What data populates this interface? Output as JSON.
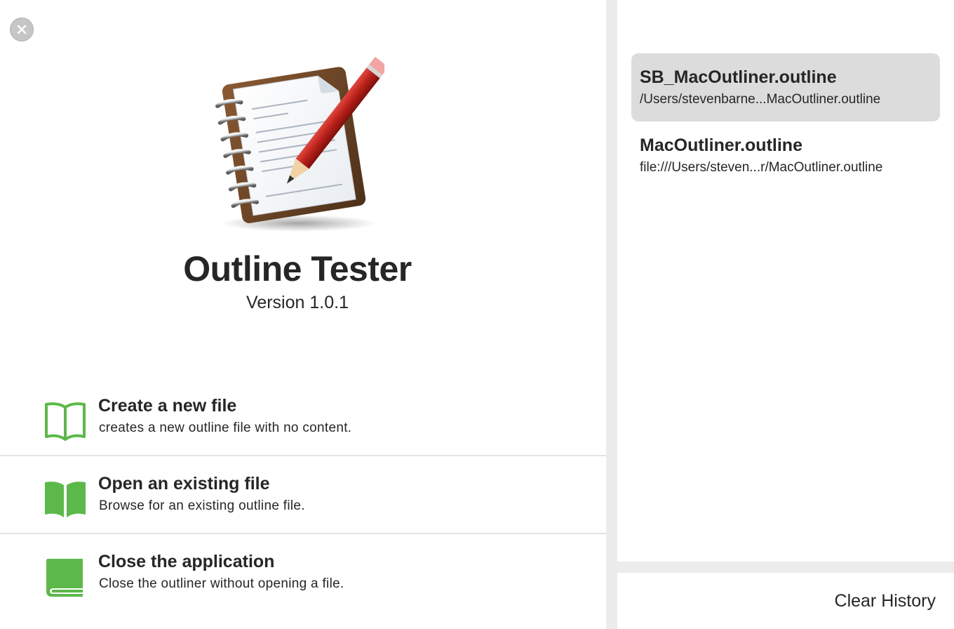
{
  "app": {
    "title": "Outline Tester",
    "version": "Version 1.0.1",
    "icon": "notebook-with-pencil-icon"
  },
  "window": {
    "close_icon": "close-icon"
  },
  "actions": [
    {
      "title": "Create a new file",
      "description": "creates a new outline file with no content.",
      "icon": "open-book-outline-icon"
    },
    {
      "title": "Open an existing file",
      "description": "Browse for an existing outline file.",
      "icon": "open-book-filled-icon"
    },
    {
      "title": "Close the application",
      "description": "Close the outliner without opening a file.",
      "icon": "closed-book-icon"
    }
  ],
  "recent": {
    "items": [
      {
        "name": "SB_MacOutliner.outline",
        "path": "/Users/stevenbarne...MacOutliner.outline",
        "selected": true
      },
      {
        "name": "MacOutliner.outline",
        "path": "file:///Users/steven...r/MacOutliner.outline",
        "selected": false
      }
    ],
    "clear_label": "Clear History"
  },
  "colors": {
    "accent_green": "#5cb84a",
    "selection_bg": "#dcdcdc",
    "separator": "#ececec"
  }
}
